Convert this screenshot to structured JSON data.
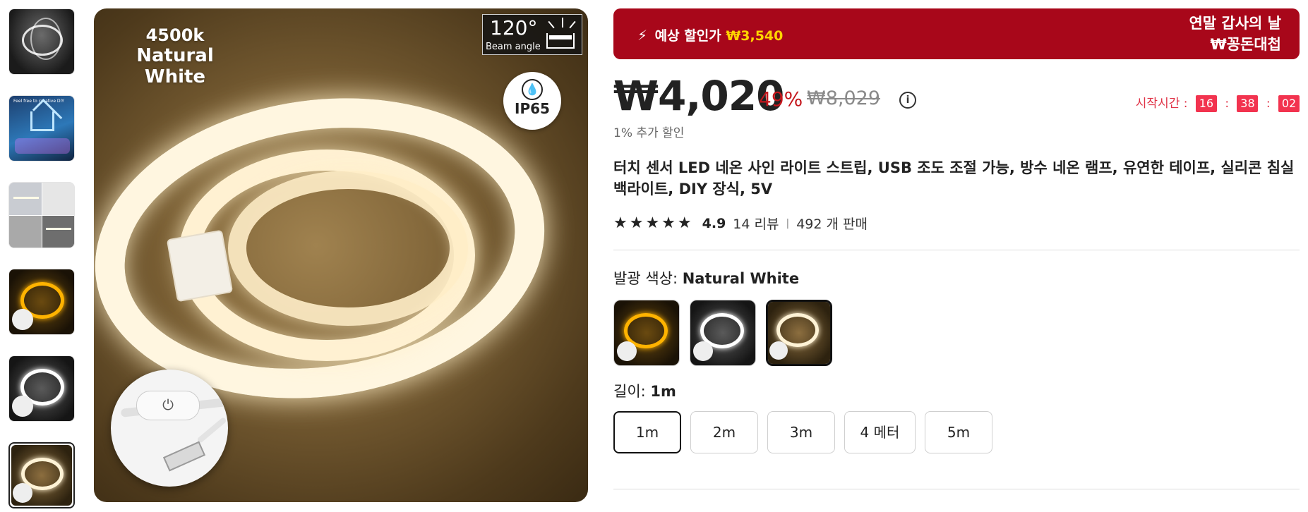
{
  "thumbnails": [
    {
      "name": "thumb-neon-dark"
    },
    {
      "name": "thumb-creative-diy",
      "caption": "Feel free to creative DIY"
    },
    {
      "name": "thumb-room-scenes"
    },
    {
      "name": "thumb-warm-white"
    },
    {
      "name": "thumb-cool-white"
    },
    {
      "name": "thumb-natural-white",
      "selected": true
    }
  ],
  "main_image": {
    "temp": "4500k",
    "color_name": "Natural White",
    "beam_degree": "120°",
    "beam_label": "Beam angle",
    "ip_rating": "IP65",
    "icons": [
      "water-drop-icon",
      "power-button-icon",
      "usb-plug-icon",
      "lamp-icon"
    ]
  },
  "promo": {
    "icon": "lightning-icon",
    "label": "예상 할인가",
    "price": "₩3,540",
    "event_line1": "연말 갑사의 날",
    "event_line2": "₩꽁돈대첩",
    "colors": {
      "bg": "#a8071a",
      "accent": "#ffd400"
    }
  },
  "pricing": {
    "price": "₩4,020",
    "discount": "49%",
    "original": "₩8,029",
    "info_icon": "i",
    "extra_discount": "1% 추가 할인"
  },
  "timer": {
    "label": "시작시간 :",
    "hh": "16",
    "mm": "38",
    "ss": "02",
    "sep": ":"
  },
  "product": {
    "title": "터치 센서 LED 네온 사인 라이트 스트립, USB 조도 조절 가능, 방수 네온 램프, 유연한 테이프, 실리콘 침실 백라이트, DIY 장식, 5V",
    "stars": "★★★★★",
    "rating": "4.9",
    "reviews": "14 리뷰",
    "divider": "|",
    "sold": "492 개 판매"
  },
  "color_option": {
    "label": "발광 색상:",
    "value": "Natural White",
    "swatches": [
      {
        "name": "swatch-warm-white"
      },
      {
        "name": "swatch-cool-white"
      },
      {
        "name": "swatch-natural-white",
        "selected": true
      }
    ]
  },
  "length_option": {
    "label": "길이:",
    "value": "1m",
    "options": [
      "1m",
      "2m",
      "3m",
      "4 메터",
      "5m"
    ],
    "selected": "1m"
  }
}
